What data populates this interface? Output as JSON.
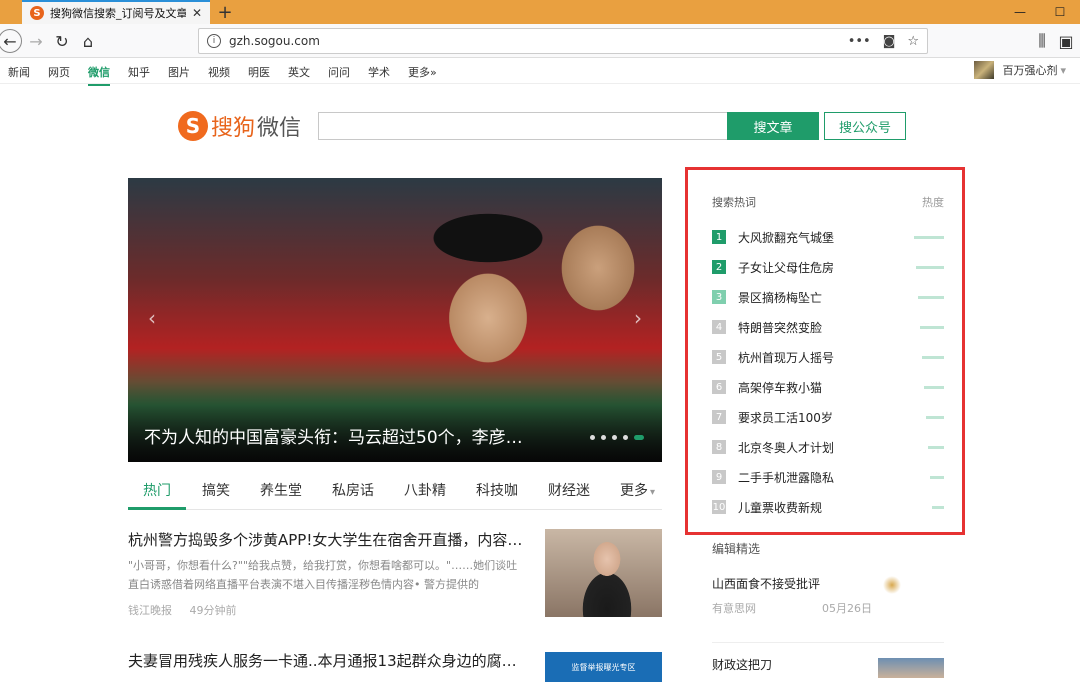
{
  "browser": {
    "tab_title": "搜狗微信搜索_订阅号及文章内",
    "url": "gzh.sogou.com",
    "new_tab": "+",
    "more": "•••"
  },
  "site_nav": {
    "items": [
      "新闻",
      "网页",
      "微信",
      "知乎",
      "图片",
      "视频",
      "明医",
      "英文",
      "问问",
      "学术",
      "更多»"
    ],
    "active": "微信",
    "username": "百万强心剂"
  },
  "logo": {
    "mark": "S",
    "brand": "搜狗",
    "product": "微信"
  },
  "search": {
    "placeholder": "",
    "article_button": "搜文章",
    "account_button": "搜公众号"
  },
  "hero": {
    "caption": "不为人知的中国富豪头衔：马云超过50个，李彦…"
  },
  "categories": [
    "热门",
    "搞笑",
    "养生堂",
    "私房话",
    "八卦精",
    "科技咖",
    "财经迷",
    "更多"
  ],
  "articles": [
    {
      "title": "杭州警方捣毁多个涉黄APP!女大学生在宿舍开直播，内容…",
      "summary": "\"小哥哥，你想看什么?\"\"给我点赞，给我打赏，你想看啥都可以。\"……她们谈吐直白诱惑借着网络直播平台表演不堪入目传播淫秽色情内容• 警方提供的",
      "source": "钱江晚报",
      "time": "49分钟前"
    },
    {
      "title": "夫妻冒用残疾人服务一卡通..本月通报13起群众身边的腐…",
      "thumb_text": "监督举报曝光专区"
    }
  ],
  "hot_words": {
    "title": "搜索热词",
    "heat_label": "热度",
    "items": [
      {
        "rank": "1",
        "text": "大风掀翻充气城堡",
        "heat": 1.0
      },
      {
        "rank": "2",
        "text": "子女让父母住危房",
        "heat": 0.93
      },
      {
        "rank": "3",
        "text": "景区摘杨梅坠亡",
        "heat": 0.87
      },
      {
        "rank": "4",
        "text": "特朗普突然变脸",
        "heat": 0.8
      },
      {
        "rank": "5",
        "text": "杭州首现万人摇号",
        "heat": 0.73
      },
      {
        "rank": "6",
        "text": "高架停车救小猫",
        "heat": 0.67
      },
      {
        "rank": "7",
        "text": "要求员工活100岁",
        "heat": 0.6
      },
      {
        "rank": "8",
        "text": "北京冬奥人才计划",
        "heat": 0.53
      },
      {
        "rank": "9",
        "text": "二手手机泄露隐私",
        "heat": 0.47
      },
      {
        "rank": "10",
        "text": "儿童票收费新规",
        "heat": 0.4
      }
    ]
  },
  "editor_picks": {
    "title": "编辑精选",
    "items": [
      {
        "title": "山西面食不接受批评",
        "source": "有意思网",
        "date": "05月26日"
      },
      {
        "title": "财政这把刀",
        "source": "",
        "date": ""
      }
    ]
  },
  "colors": {
    "brand_green": "#1f9c6a",
    "brand_orange": "#e8641b",
    "highlight_red": "#e63232",
    "rank_top": "#1f9c6a",
    "rank_third": "#7fcfae",
    "rank_other": "#c8c8c8"
  }
}
